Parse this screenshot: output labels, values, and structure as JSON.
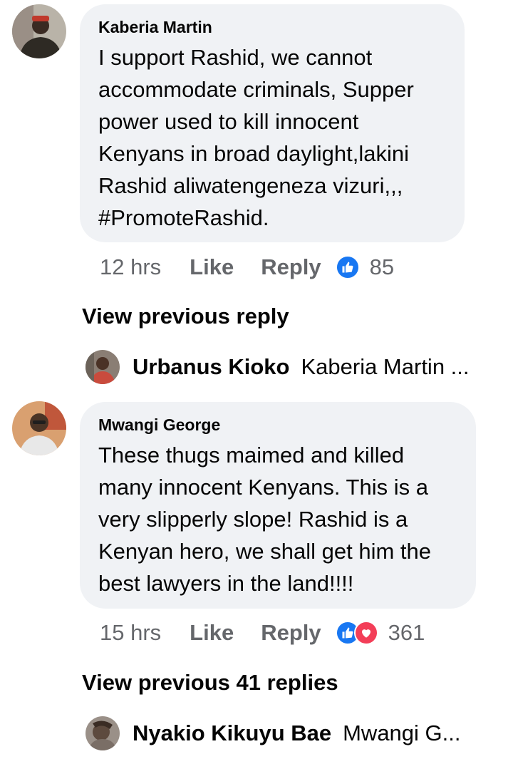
{
  "comments": [
    {
      "author": "Kaberia Martin",
      "text": "I support Rashid, we cannot\naccommodate criminals, Supper\npower used to kill innocent\nKenyans in broad daylight,lakini\nRashid aliwatengeneza vizuri,,,\n#PromoteRashid.",
      "time": "12 hrs",
      "like_label": "Like",
      "reply_label": "Reply",
      "reactions": [
        "like-icon"
      ],
      "reaction_count": "85",
      "view_previous": "View previous reply",
      "latest_reply": {
        "author": "Urbanus Kioko",
        "snippet": "Kaberia Martin ..."
      }
    },
    {
      "author": "Mwangi George",
      "text": "These thugs maimed and killed\nmany innocent Kenyans. This is a\nvery slipperly slope! Rashid is a\nKenyan hero, we shall get him the\nbest lawyers in the land!!!!",
      "time": "15 hrs",
      "like_label": "Like",
      "reply_label": "Reply",
      "reactions": [
        "like-icon",
        "love-icon"
      ],
      "reaction_count": "361",
      "view_previous": "View previous 41 replies",
      "latest_reply": {
        "author": "Nyakio Kikuyu Bae",
        "snippet": "Mwangi G..."
      }
    }
  ],
  "colors": {
    "bubble": "#f0f2f5",
    "meta": "#65676b",
    "like": "#1877f2",
    "love": "#f33e58"
  }
}
